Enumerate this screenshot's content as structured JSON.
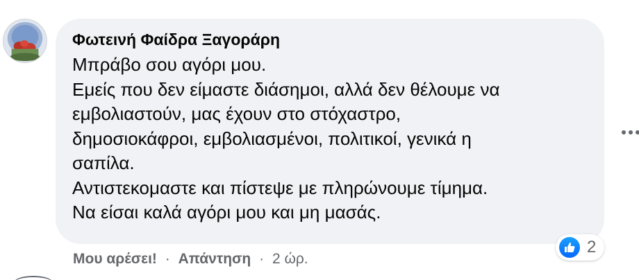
{
  "comment": {
    "author": "Φωτεινή Φαίδρα Ξαγοράρη",
    "lines": [
      "Μπράβο σου αγόρι μου.",
      "Εμείς που δεν είμαστε διάσημοι, αλλά δεν θέλουμε να",
      "εμβολιαστούν, μας έχουν στο στόχαστρο,",
      "δημοσιοκάφροι, εμβολιασμένοι, πολιτικοί, γενικά η",
      "σαπίλα.",
      "Αντιστεκομαστε και πίστεψε με πληρώνουμε τίμημα.",
      "Να είσαι καλά αγόρι μου και μη μασάς."
    ],
    "reactions": {
      "icon": "like-icon",
      "color": "#1877f2",
      "count": "2"
    },
    "actions": {
      "like_label": "Μου αρέσει!",
      "reply_label": "Απάντηση",
      "separator": "·",
      "time": "2 ώρ."
    }
  },
  "icons": {
    "more": "more-options-icon",
    "avatar": "avatar"
  },
  "colors": {
    "bubble": "#f0f2f5",
    "secondary_text": "#65676b",
    "like_blue": "#1877f2"
  }
}
